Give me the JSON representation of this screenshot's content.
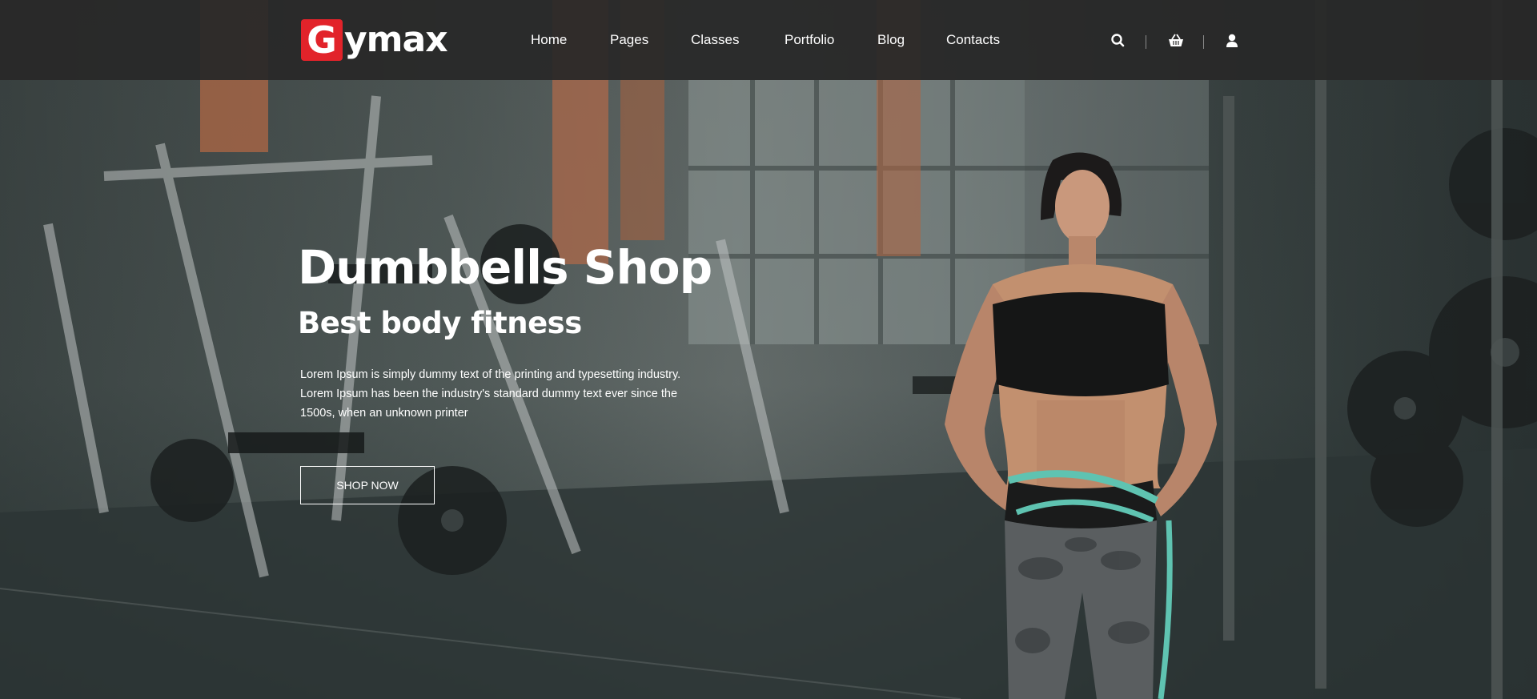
{
  "brand": {
    "logo_letter": "G",
    "logo_rest": "ymax",
    "accent_color": "#e2232a"
  },
  "nav": {
    "items": [
      {
        "label": "Home"
      },
      {
        "label": "Pages"
      },
      {
        "label": "Classes"
      },
      {
        "label": "Portfolio"
      },
      {
        "label": "Blog"
      },
      {
        "label": "Contacts"
      }
    ]
  },
  "header_icons": [
    "search-icon",
    "basket-icon",
    "user-icon"
  ],
  "hero": {
    "title": "Dumbbells Shop",
    "subtitle": "Best body fitness",
    "description_lines": [
      "Lorem Ipsum is simply dummy text of the printing and typesetting industry.",
      "Lorem Ipsum has been the industry's standard dummy text ever since the",
      "1500s, when an unknown printer"
    ],
    "cta_label": "SHOP NOW"
  }
}
